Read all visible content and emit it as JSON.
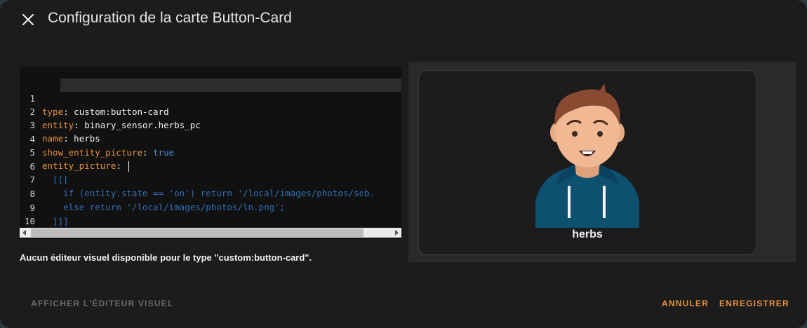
{
  "dialog": {
    "title": "Configuration de la carte Button-Card",
    "close_icon": "close-icon"
  },
  "editor": {
    "lines": [
      {
        "num": "1",
        "key": "type",
        "sep": ": ",
        "value": "custom:button-card"
      },
      {
        "num": "2",
        "key": "entity",
        "sep": ": ",
        "value": "binary_sensor.herbs_pc"
      },
      {
        "num": "3",
        "key": "name",
        "sep": ": ",
        "value": "herbs"
      },
      {
        "num": "4",
        "key": "show_entity_picture",
        "sep": ": ",
        "value": "true"
      },
      {
        "num": "5",
        "key": "entity_picture",
        "sep": ": ",
        "value": ""
      },
      {
        "num": "6",
        "text": "  [[["
      },
      {
        "num": "7",
        "text": "    if (entity.state == 'on') return '/local/images/photos/seb."
      },
      {
        "num": "8",
        "text": "    else return '/local/images/photos/ln.png';"
      },
      {
        "num": "9",
        "text": "  ]]]"
      },
      {
        "num": "10",
        "text": ""
      }
    ]
  },
  "notice": "Aucun éditeur visuel disponible pour le type \"custom:button-card\".",
  "preview": {
    "card_name": "herbs",
    "avatar_icon": "person-avatar"
  },
  "footer": {
    "show_visual_editor": "AFFICHER L'ÉDITEUR VISUEL",
    "cancel": "ANNULER",
    "save": "ENREGISTRER"
  },
  "colors": {
    "accent": "#e7923c",
    "key": "#e7923c",
    "boolean": "#4a8bd6",
    "template": "#2d6fb8",
    "dialog_bg": "#1c1c1c"
  }
}
